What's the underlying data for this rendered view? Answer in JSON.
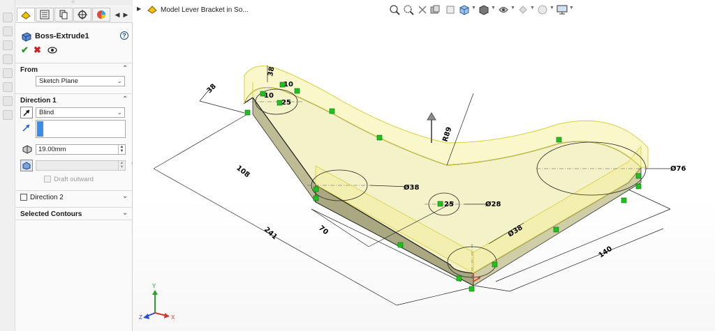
{
  "feature_manager": {
    "tabs": [
      {
        "icon": "feature-manager-icon"
      },
      {
        "icon": "property-manager-icon"
      },
      {
        "icon": "configuration-manager-icon"
      },
      {
        "icon": "dimxpert-icon"
      },
      {
        "icon": "display-manager-icon"
      }
    ]
  },
  "property_manager": {
    "title": "Boss-Extrude1",
    "help": "?",
    "from": {
      "label": "From",
      "selected": "Sketch Plane"
    },
    "direction1": {
      "label": "Direction 1",
      "end_condition": "Blind",
      "depth": "19.00mm",
      "draft_outward": "Draft outward"
    },
    "direction2": {
      "label": "Direction 2",
      "checked": false
    },
    "selected_contours": {
      "label": "Selected Contours"
    }
  },
  "graphics": {
    "breadcrumb": "Model Lever Bracket in So...",
    "triad_labels": {
      "x": "X",
      "y": "Y",
      "z": "Z"
    },
    "dimensions": {
      "d1": "38",
      "d2": "38",
      "d3": "10",
      "d4": "10",
      "d5": "25",
      "d6": "108",
      "d7": "241",
      "d8": "70",
      "d9": "R89",
      "d10": "Ø38",
      "d11": "25",
      "d12": "Ø28",
      "d13": "Ø76",
      "d14": "Ø38",
      "d15": "140"
    }
  },
  "colors": {
    "face_top": "#f7f5c4",
    "face_side": "#c9c8a0",
    "accent_green": "#1ec21e",
    "select_blue": "#1b73e8"
  }
}
